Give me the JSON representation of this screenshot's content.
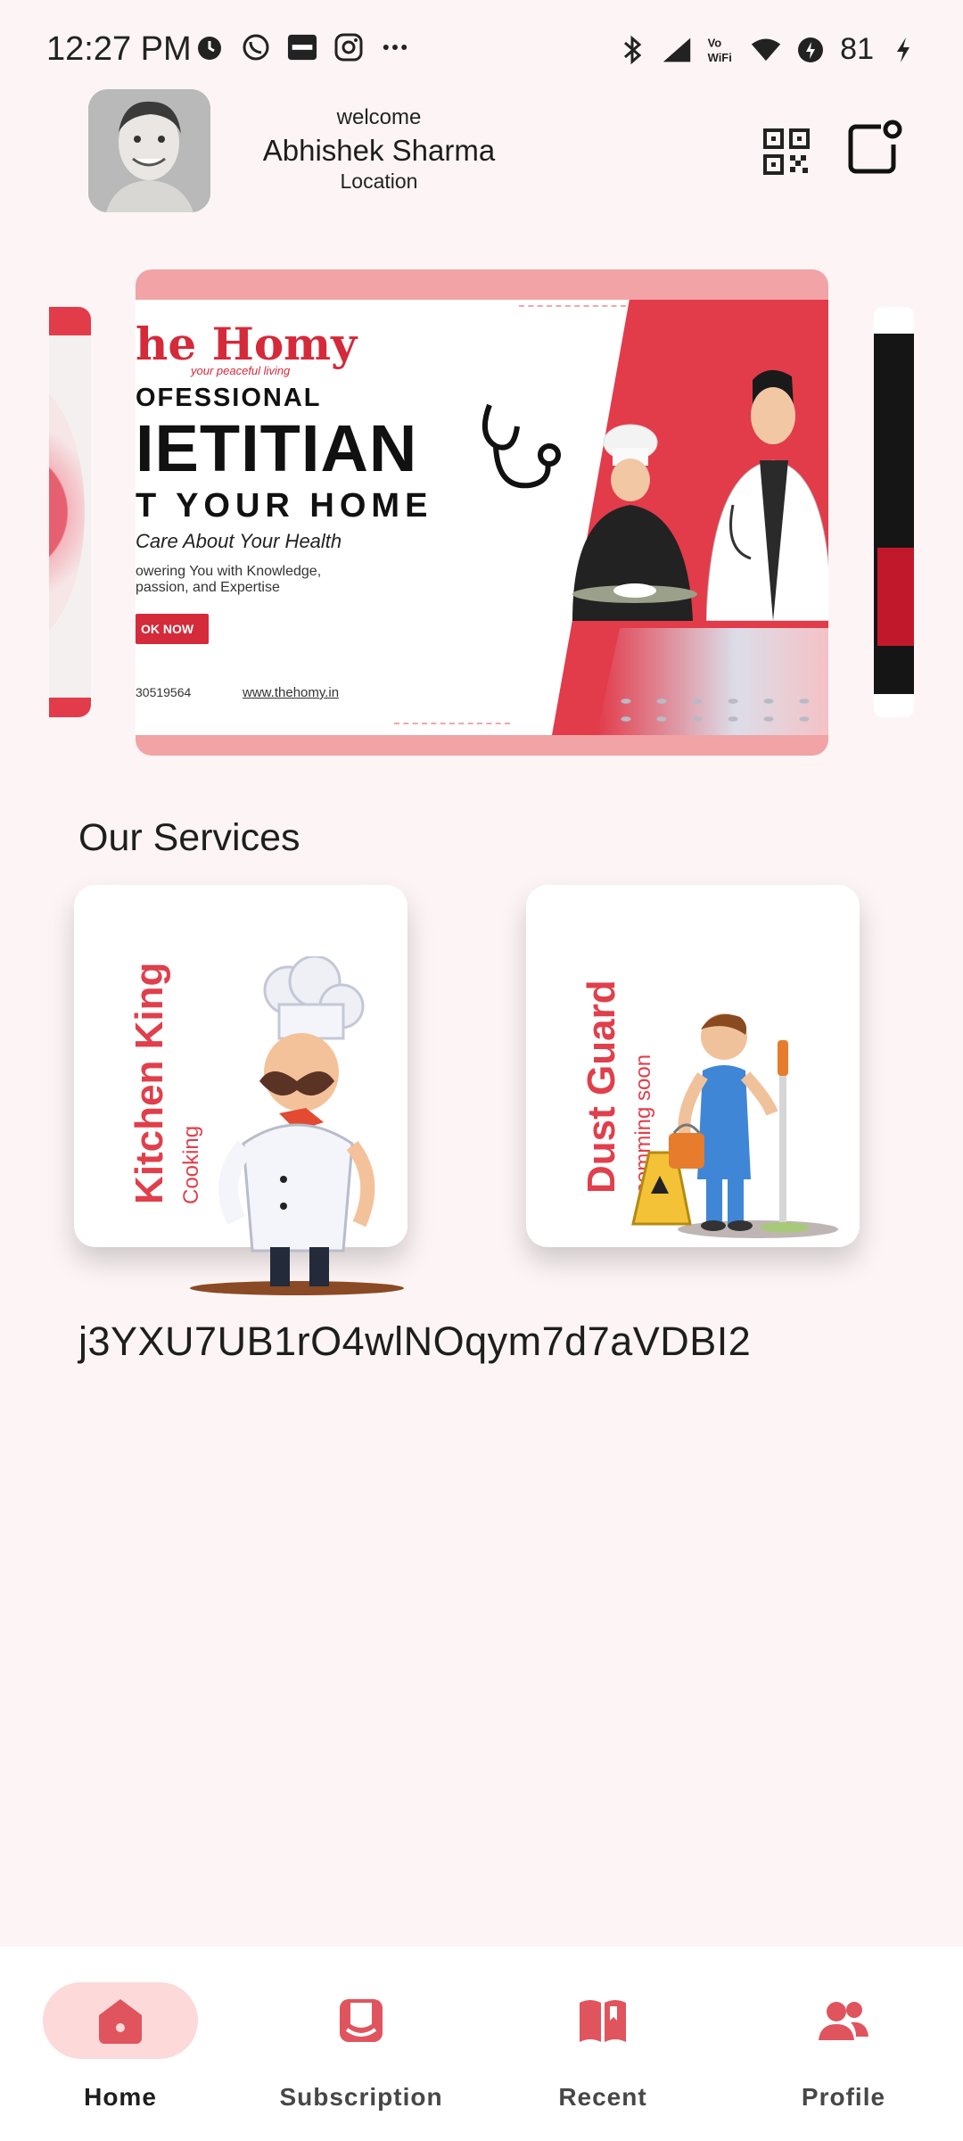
{
  "status_bar": {
    "time": "12:27 PM",
    "battery": "81",
    "left_icons": [
      "alarm-icon",
      "whatsapp-icon",
      "paytm-icon",
      "instagram-icon",
      "more-dots-icon"
    ],
    "right_icons": [
      "bluetooth-icon",
      "signal-icon",
      "vowifi-icon",
      "wifi-icon",
      "data-saver-icon",
      "charging-icon"
    ]
  },
  "header": {
    "welcome": "welcome",
    "user_name": "Abhishek Sharma",
    "location": "Location",
    "qr_icon": "qr-code-icon",
    "share_icon": "share-notification-icon"
  },
  "banner": {
    "brand": "he Homy",
    "tagline": "your peaceful living",
    "line1": "OFESSIONAL",
    "line2": "IETITIAN",
    "line3": "T YOUR HOME",
    "line4": "Care About Your Health",
    "line5": "owering You with Knowledge,",
    "line6": "passion, and Expertise",
    "cta": "OK NOW",
    "phone": "30519564",
    "website": "www.thehomy.in"
  },
  "services": {
    "title": "Our Services",
    "items": [
      {
        "name": "Kitchen King",
        "subtitle": "Cooking"
      },
      {
        "name": "Dust Guard",
        "subtitle": "comming soon"
      }
    ]
  },
  "token": "j3YXU7UB1rO4wlNOqym7d7aVDBI2",
  "nav": {
    "items": [
      {
        "label": "Home",
        "icon": "home-icon",
        "active": true
      },
      {
        "label": "Subscription",
        "icon": "subscription-icon",
        "active": false
      },
      {
        "label": "Recent",
        "icon": "recent-book-icon",
        "active": false
      },
      {
        "label": "Profile",
        "icon": "profile-people-icon",
        "active": false
      }
    ]
  },
  "colors": {
    "accent": "#e03f4b",
    "background": "#fdf5f5",
    "active_pill": "#fdd9d9",
    "icon_red": "#e0545e"
  }
}
